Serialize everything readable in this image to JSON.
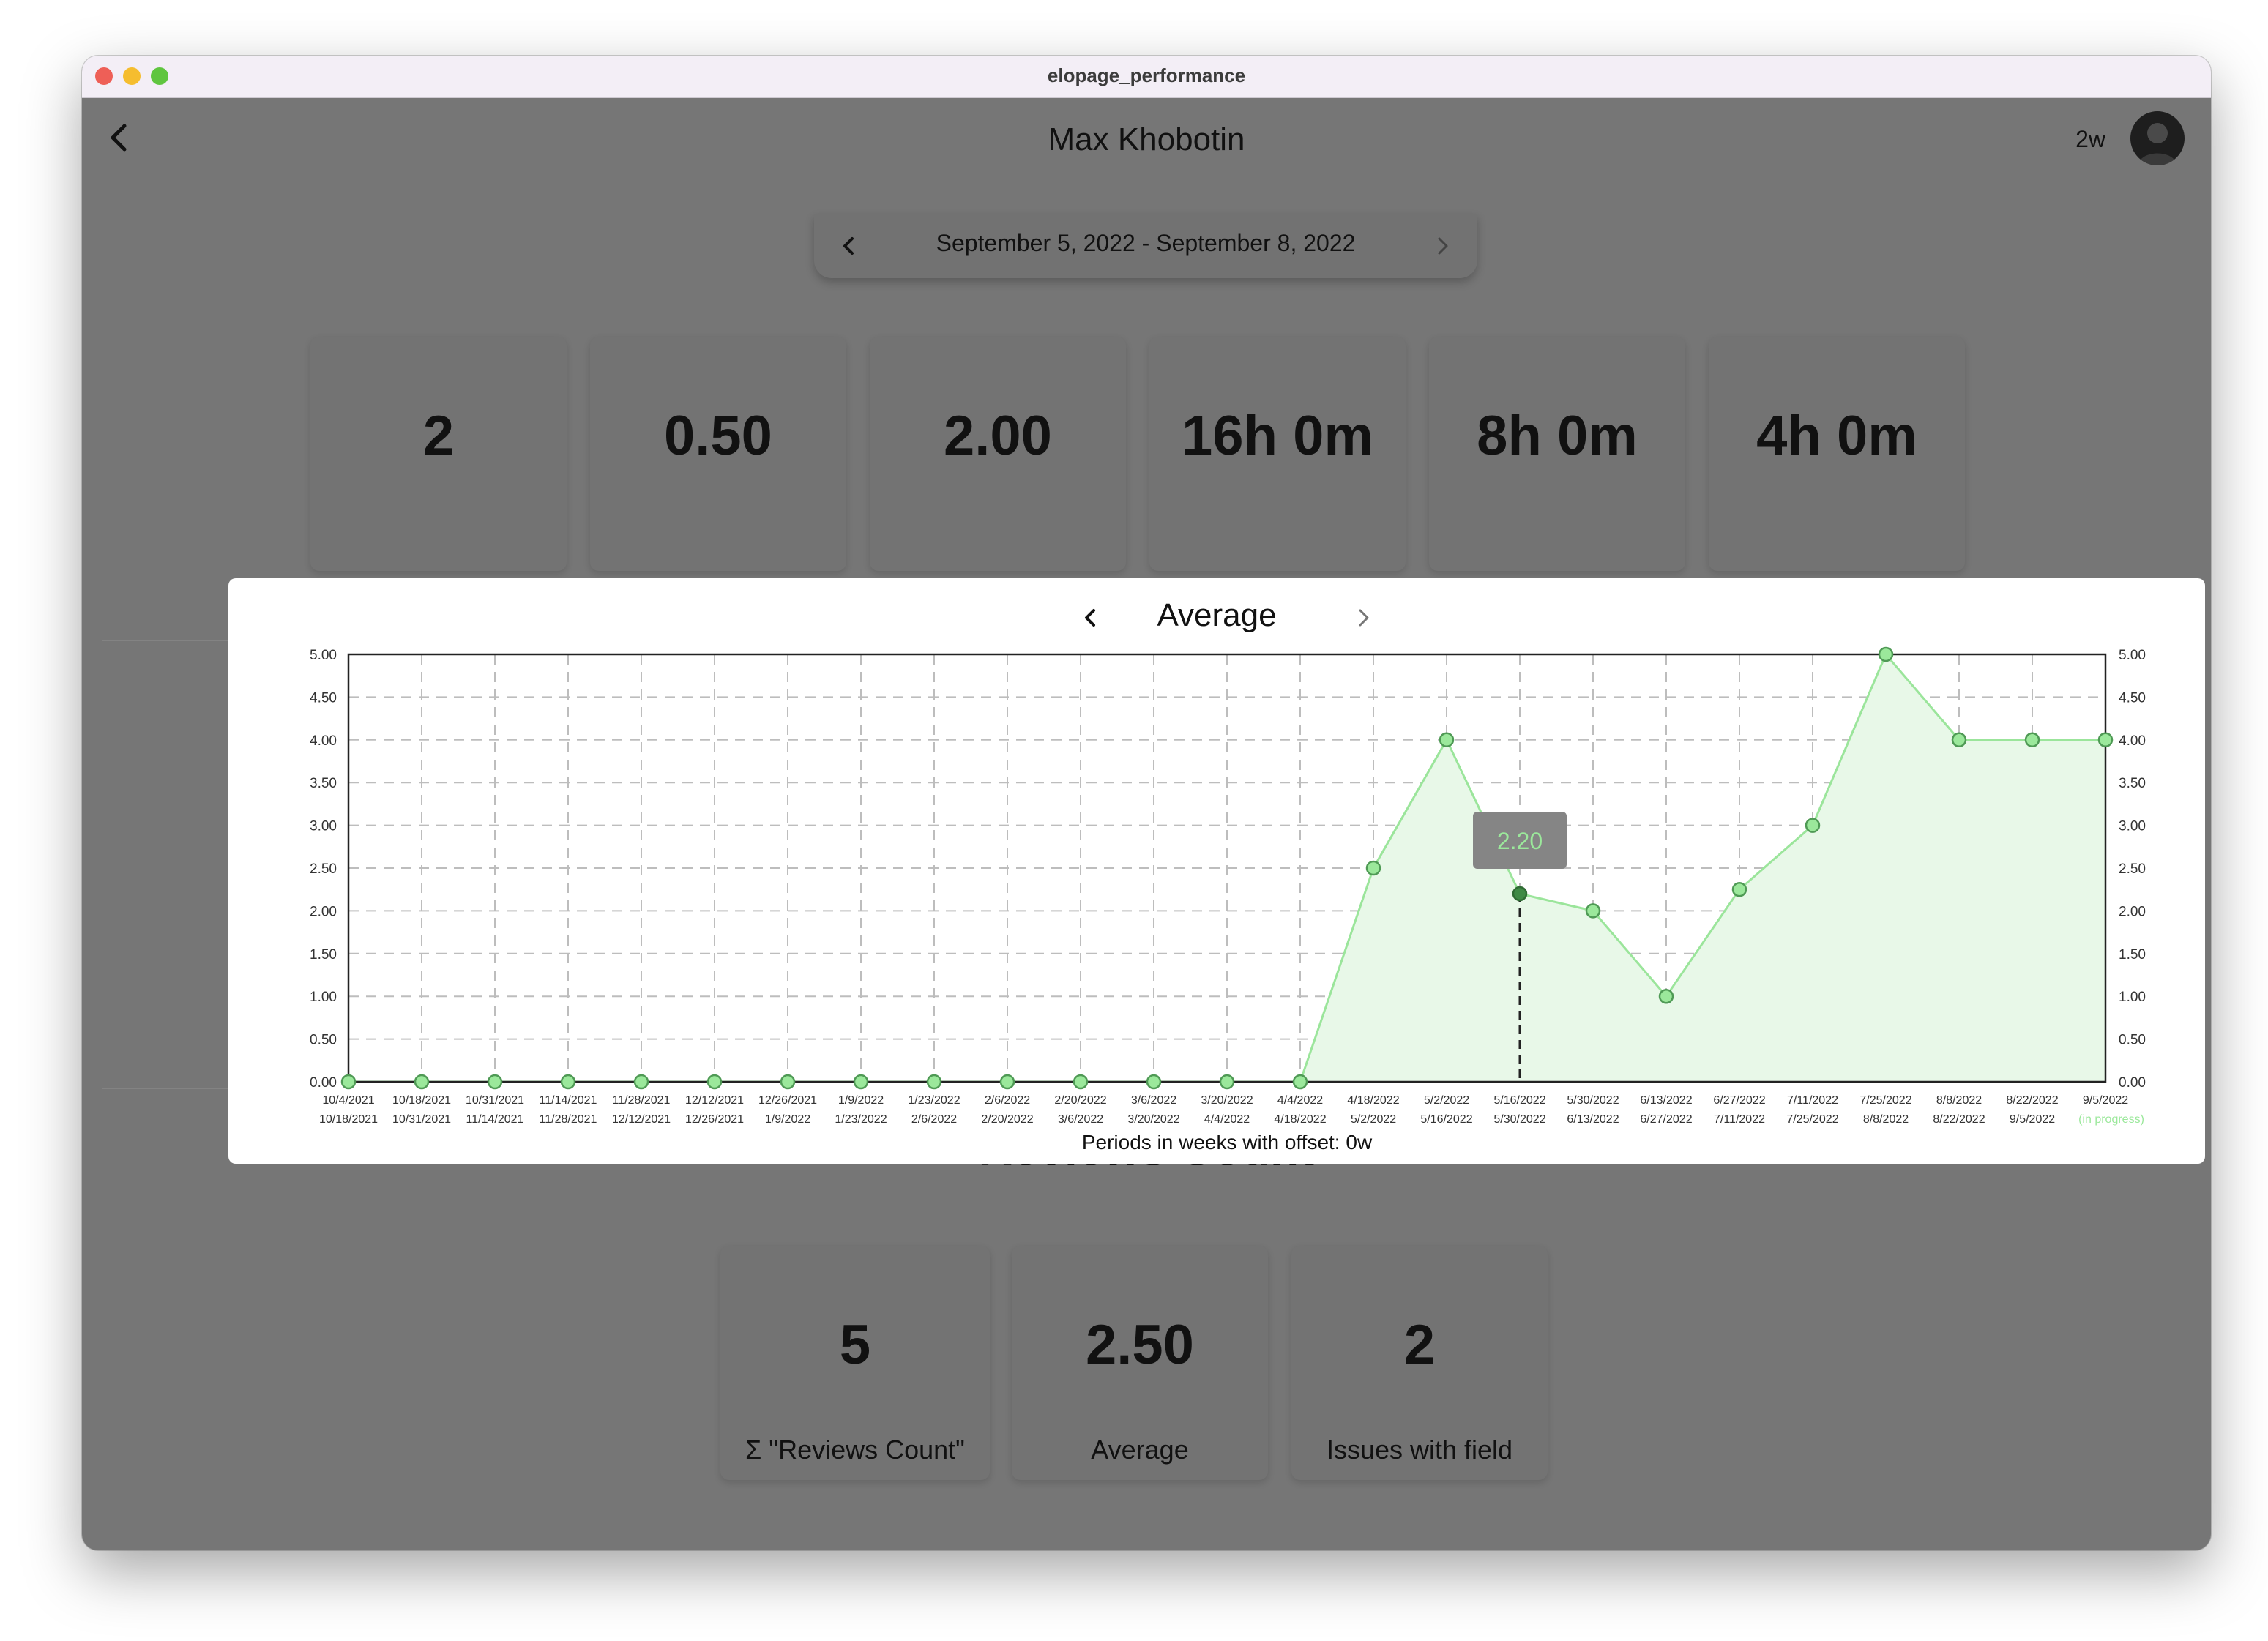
{
  "window": {
    "title": "elopage_performance"
  },
  "header": {
    "user_name": "Max Khobotin",
    "period": "2w"
  },
  "date_range": {
    "label": "September 5, 2022 - September 8, 2022"
  },
  "top_stats": [
    {
      "value": "2"
    },
    {
      "value": "0.50"
    },
    {
      "value": "2.00"
    },
    {
      "value": "16h 0m"
    },
    {
      "value": "8h 0m"
    },
    {
      "value": "4h 0m"
    }
  ],
  "section": {
    "title": "Reviews Count"
  },
  "bottom_stats": [
    {
      "value": "5",
      "label": "Σ \"Reviews Count\""
    },
    {
      "value": "2.50",
      "label": "Average"
    },
    {
      "value": "2",
      "label": "Issues with field"
    }
  ],
  "modal": {
    "chart_title": "Average"
  },
  "chart_data": {
    "type": "area",
    "title": "Average",
    "xlabel": "Periods in weeks with offset: 0w",
    "ylim": [
      0,
      5
    ],
    "yticks": [
      "0.00",
      "0.50",
      "1.00",
      "1.50",
      "2.00",
      "2.50",
      "3.00",
      "3.50",
      "4.00",
      "4.50",
      "5.00"
    ],
    "x_start": [
      "10/4/2021",
      "10/18/2021",
      "10/31/2021",
      "11/14/2021",
      "11/28/2021",
      "12/12/2021",
      "12/26/2021",
      "1/9/2022",
      "1/23/2022",
      "2/6/2022",
      "2/20/2022",
      "3/6/2022",
      "3/20/2022",
      "4/4/2022",
      "4/18/2022",
      "5/2/2022",
      "5/16/2022",
      "5/30/2022",
      "6/13/2022",
      "6/27/2022",
      "7/11/2022",
      "7/25/2022",
      "8/8/2022",
      "8/22/2022",
      "9/5/2022"
    ],
    "x_end": [
      "10/18/2021",
      "10/31/2021",
      "11/14/2021",
      "11/28/2021",
      "12/12/2021",
      "12/26/2021",
      "1/9/2022",
      "1/23/2022",
      "2/6/2022",
      "2/20/2022",
      "3/6/2022",
      "3/20/2022",
      "4/4/2022",
      "4/18/2022",
      "5/2/2022",
      "5/16/2022",
      "5/30/2022",
      "6/13/2022",
      "6/27/2022",
      "7/11/2022",
      "7/25/2022",
      "8/8/2022",
      "8/22/2022",
      "9/5/2022",
      "(in progress)"
    ],
    "values": [
      0,
      0,
      0,
      0,
      0,
      0,
      0,
      0,
      0,
      0,
      0,
      0,
      0,
      0,
      2.5,
      4.0,
      2.2,
      2.0,
      1.0,
      2.25,
      3.0,
      5.0,
      4.0,
      4.0,
      4.0
    ],
    "grid": true,
    "highlight": {
      "index": 16,
      "label": "2.20"
    },
    "colors": {
      "line": "#9be59b",
      "fill": "#e8f8e8",
      "point": "#9be89b",
      "highlight_point": "#3f8a45",
      "tooltip_bg": "#858585",
      "tooltip_text": "#9be89b",
      "in_progress": "#9be89b"
    }
  }
}
